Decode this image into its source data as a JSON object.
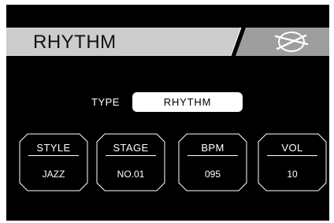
{
  "header": {
    "title": "RHYTHM",
    "icon": "drumsticks-icon"
  },
  "type": {
    "label": "TYPE",
    "value": "RHYTHM"
  },
  "params": [
    {
      "label": "STYLE",
      "value": "JAZZ"
    },
    {
      "label": "STAGE",
      "value": "NO.01"
    },
    {
      "label": "BPM",
      "value": "095"
    },
    {
      "label": "VOL",
      "value": "10"
    }
  ],
  "colors": {
    "background": "#000000",
    "header_bar": "#cccccc",
    "header_badge": "#9e9e9e",
    "text": "#ffffff"
  }
}
